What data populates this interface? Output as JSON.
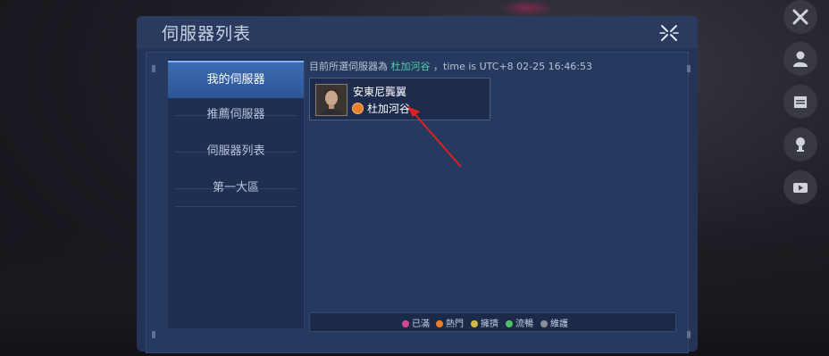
{
  "panel": {
    "title": "伺服器列表"
  },
  "menu": {
    "items": [
      {
        "label": "我的伺服器"
      },
      {
        "label": "推薦伺服器"
      },
      {
        "label": "伺服器列表"
      },
      {
        "label": "第一大區"
      }
    ]
  },
  "current": {
    "prefix": "目前所選伺服器為",
    "server": "杜加河谷",
    "suffix": "，time is UTC+8 02-25 16:46:53"
  },
  "server_card": {
    "character_name": "安東尼龔翼",
    "server_name": "杜加河谷",
    "status_icon": "status-hot-icon",
    "status_color": "#e8802a"
  },
  "legend": {
    "items": [
      {
        "label": "已滿",
        "color": "#d04a8c"
      },
      {
        "label": "熱門",
        "color": "#e8802a"
      },
      {
        "label": "擁擠",
        "color": "#d9b64a"
      },
      {
        "label": "流暢",
        "color": "#4fbf6a"
      },
      {
        "label": "維護",
        "color": "#8a8f99"
      }
    ]
  },
  "side_icons": [
    "tools-icon",
    "user-icon",
    "calendar-icon",
    "trophy-icon",
    "video-icon"
  ],
  "annotation": {
    "arrow_color": "#e02020"
  }
}
